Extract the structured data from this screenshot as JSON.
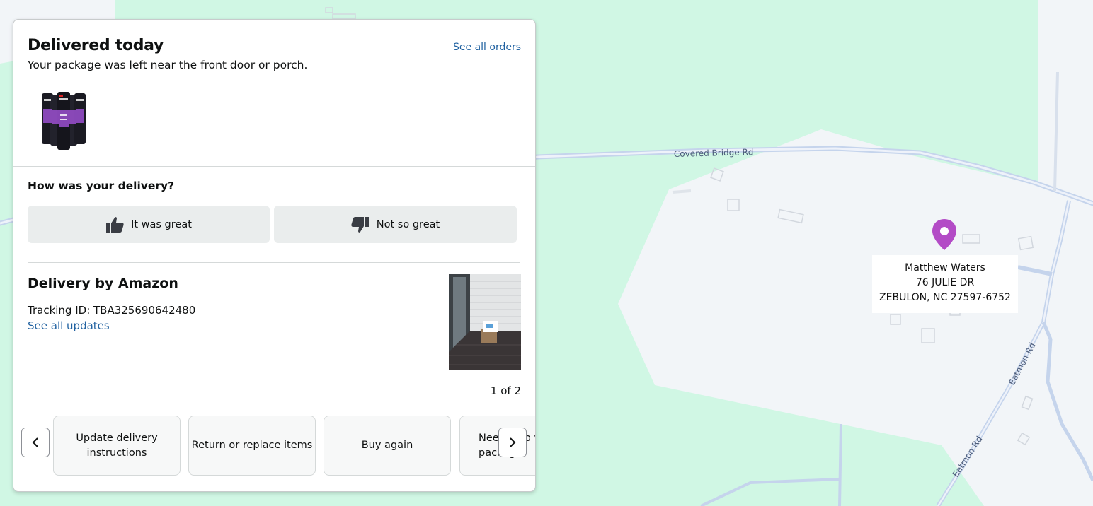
{
  "map": {
    "roads": [
      "Covered Bridge Rd",
      "Eatmon Rd",
      "Eatmon Rd"
    ],
    "colors": {
      "land": "#d0f7e4",
      "parcel": "#f2f5f8",
      "road": "#c5d4ec"
    }
  },
  "address": {
    "name": "Matthew Waters",
    "street": "76 JULIE DR",
    "city": "ZEBULON, NC 27597-6752",
    "pin_color": "#b34bc6"
  },
  "status": {
    "title": "Delivered today",
    "subtitle": "Your package was left near the front door or porch.",
    "see_all_orders": "See all orders"
  },
  "product": {
    "image_icon": "spray-cans-product"
  },
  "feedback": {
    "question": "How was your delivery?",
    "positive": "It was great",
    "negative": "Not so great"
  },
  "delivery": {
    "carrier": "Delivery by Amazon",
    "tracking": "Tracking ID: TBA325690642480",
    "see_updates": "See all updates",
    "photo_pager": "1 of 2"
  },
  "actions": {
    "items": [
      {
        "label_line1": "Update delivery",
        "label_line2": "instructions"
      },
      {
        "label": "Return or replace items"
      },
      {
        "label": "Buy again"
      },
      {
        "label_line1": "Need help with",
        "label_line2": "package?"
      }
    ],
    "prev_icon": "chevron-left-icon",
    "next_icon": "chevron-right-icon"
  }
}
